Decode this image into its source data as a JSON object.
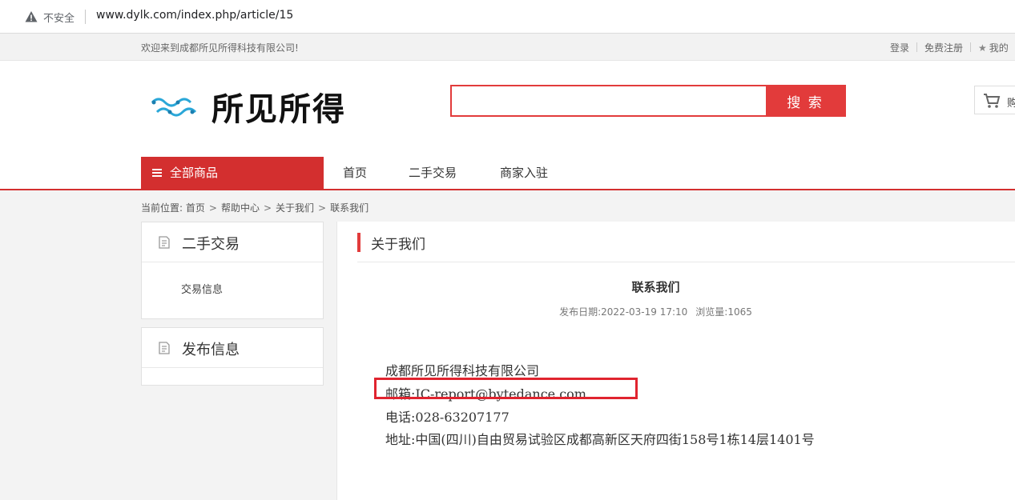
{
  "browser": {
    "security_label": "不安全",
    "url": "www.dylk.com/index.php/article/15"
  },
  "top_strip": {
    "welcome": "欢迎来到成都所见所得科技有限公司!",
    "login": "登录",
    "register": "免费注册",
    "mine": "我的"
  },
  "header": {
    "logo_text": "所见所得",
    "search_placeholder": "",
    "search_button": "搜 索",
    "cart_label": "购"
  },
  "nav": {
    "all_categories": "全部商品",
    "items": [
      "首页",
      "二手交易",
      "商家入驻"
    ]
  },
  "breadcrumb": {
    "prefix": "当前位置:",
    "items": [
      "首页",
      "帮助中心",
      "关于我们",
      "联系我们"
    ]
  },
  "sidebar": {
    "boxes": [
      {
        "title": "二手交易",
        "items": [
          "交易信息"
        ]
      },
      {
        "title": "发布信息",
        "items": []
      }
    ]
  },
  "main": {
    "section_title": "关于我们",
    "article_title": "联系我们",
    "publish_label": "发布日期:",
    "publish_date": "2022-03-19 17:10",
    "views_label": "浏览量:",
    "views": "1065",
    "lines": [
      "成都所见所得科技有限公司",
      "邮箱:IC-report@bytedance.com",
      "电话:028-63207177",
      "地址:中国(四川)自由贸易试验区成都高新区天府四街158号1栋14层1401号"
    ]
  },
  "colors": {
    "accent": "#d32f2f",
    "search_red": "#e23b3b",
    "highlight_box": "#e0242f"
  }
}
